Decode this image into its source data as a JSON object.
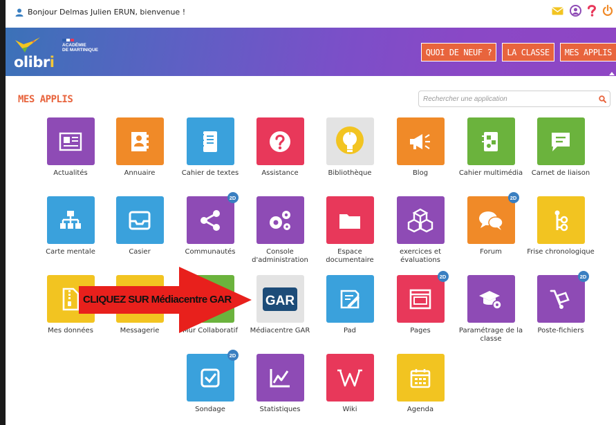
{
  "header": {
    "greeting": "Bonjour Delmas Julien ERUN, bienvenue !",
    "icons": [
      "user-icon",
      "mail-icon",
      "account-icon",
      "help-icon",
      "power-icon"
    ]
  },
  "banner": {
    "logo_text_start": "olibr",
    "logo_text_i": "i",
    "academie_line1": "ACADÉMIE",
    "academie_line2": "DE MARTINIQUE",
    "nav": [
      "QUOI DE NEUF ?",
      "LA CLASSE",
      "MES APPLIS"
    ]
  },
  "main": {
    "title": "MES APPLIS",
    "search_placeholder": "Rechercher une application",
    "apps": [
      {
        "label": "Actualités",
        "icon": "newspaper-icon",
        "color": "#8e4bb5"
      },
      {
        "label": "Annuaire",
        "icon": "contact-book-icon",
        "color": "#f08a28"
      },
      {
        "label": "Cahier de textes",
        "icon": "notebook-icon",
        "color": "#3aa1dc"
      },
      {
        "label": "Assistance",
        "icon": "question-icon",
        "color": "#e8385a"
      },
      {
        "label": "Bibliothèque",
        "icon": "lightbulb-icon",
        "color": "#e3e3e3"
      },
      {
        "label": "Blog",
        "icon": "megaphone-icon",
        "color": "#f08a28"
      },
      {
        "label": "Cahier multimédia",
        "icon": "multimedia-notebook-icon",
        "color": "#6bb33d"
      },
      {
        "label": "Carnet de liaison",
        "icon": "speech-note-icon",
        "color": "#6bb33d"
      },
      {
        "label": "Carte mentale",
        "icon": "org-chart-icon",
        "color": "#3aa1dc"
      },
      {
        "label": "Casier",
        "icon": "inbox-tray-icon",
        "color": "#3aa1dc"
      },
      {
        "label": "Communautés",
        "icon": "share-icon",
        "color": "#8e4bb5",
        "badge": "2D"
      },
      {
        "label": "Console d'administration",
        "icon": "gears-icon",
        "color": "#8e4bb5"
      },
      {
        "label": "Espace documentaire",
        "icon": "folder-icon",
        "color": "#e8385a"
      },
      {
        "label": "exercices et évaluations",
        "icon": "cubes-icon",
        "color": "#8e4bb5"
      },
      {
        "label": "Forum",
        "icon": "chat-bubbles-icon",
        "color": "#f08a28",
        "badge": "2D"
      },
      {
        "label": "Frise chronologique",
        "icon": "timeline-icon",
        "color": "#f2c421"
      },
      {
        "label": "Mes données",
        "icon": "zip-file-icon",
        "color": "#f2c421"
      },
      {
        "label": "Messagerie",
        "icon": "envelope-icon",
        "color": "#f2c421"
      },
      {
        "label": "Mur Collaboratif",
        "icon": "wall-icon",
        "color": "#6bb33d"
      },
      {
        "label": "Médiacentre GAR",
        "icon": "gar-logo-icon",
        "color": "#e3e3e3",
        "logo_text": "GAR"
      },
      {
        "label": "Pad",
        "icon": "pad-icon",
        "color": "#3aa1dc"
      },
      {
        "label": "Pages",
        "icon": "pages-icon",
        "color": "#e8385a",
        "badge": "2D"
      },
      {
        "label": "Paramétrage de la classe",
        "icon": "graduation-gear-icon",
        "color": "#8e4bb5"
      },
      {
        "label": "Poste-fichiers",
        "icon": "hand-truck-icon",
        "color": "#8e4bb5",
        "badge": "2D"
      },
      {
        "label": "Sondage",
        "icon": "checkbox-icon",
        "color": "#3aa1dc",
        "badge": "2D"
      },
      {
        "label": "Statistiques",
        "icon": "line-chart-icon",
        "color": "#8e4bb5"
      },
      {
        "label": "Wiki",
        "icon": "wikipedia-icon",
        "color": "#e8385a"
      },
      {
        "label": "Agenda",
        "icon": "calendar-icon",
        "color": "#f2c421"
      }
    ]
  },
  "annotation": {
    "text": "CLIQUEZ SUR Médiacentre GAR",
    "arrow_color": "#e8201c"
  }
}
